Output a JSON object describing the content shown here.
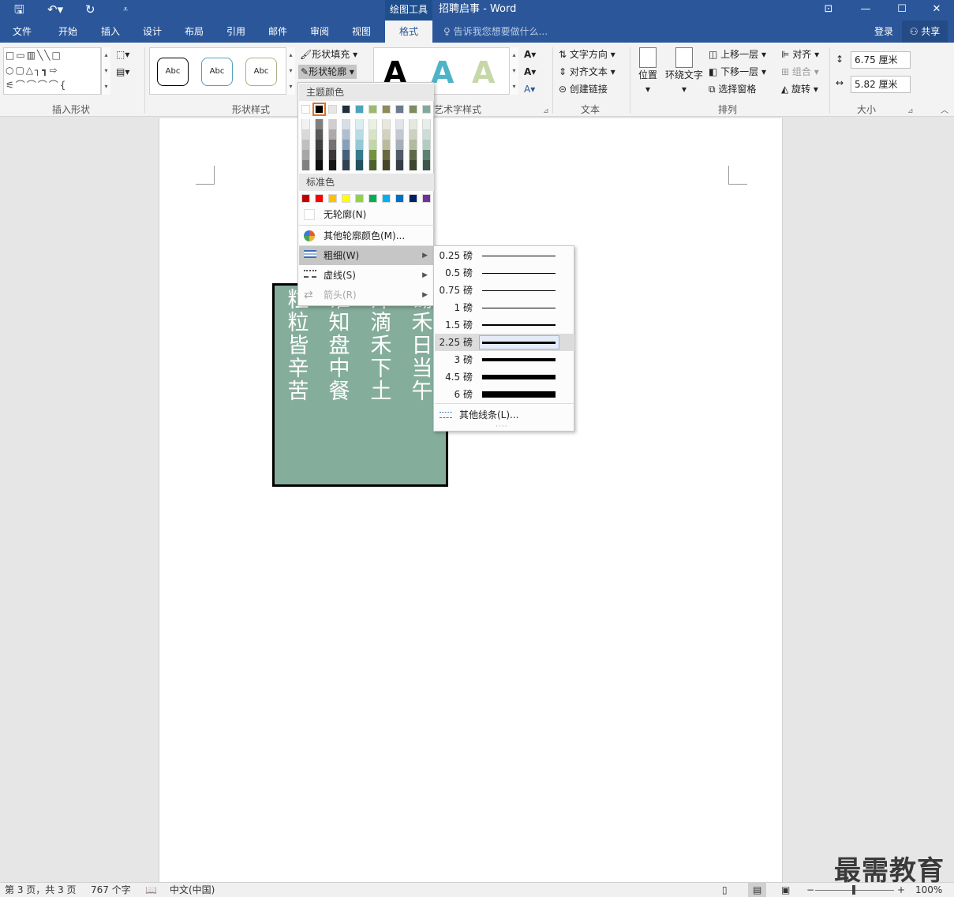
{
  "app": {
    "window_title": "招聘启事 - Word",
    "context_tab_group": "绘图工具"
  },
  "tabs": [
    "文件",
    "开始",
    "插入",
    "设计",
    "布局",
    "引用",
    "邮件",
    "审阅",
    "视图",
    "格式"
  ],
  "active_tab": "格式",
  "tell_me": "告诉我您想要做什么...",
  "login": "登录",
  "share": "共享",
  "ribbon": {
    "groups": [
      "插入形状",
      "形状样式",
      "艺术字样式",
      "文本",
      "排列",
      "大小"
    ],
    "shape_styles_sample": "Abc",
    "wordart_sample": "A",
    "shape_fill": "形状填充",
    "shape_outline": "形状轮廓",
    "text_direction": "文字方向",
    "align_text": "对齐文本",
    "create_link": "创建链接",
    "position": "位置",
    "wrap_text": "环绕文字",
    "bring_forward": "上移一层",
    "send_backward": "下移一层",
    "selection_pane": "选择窗格",
    "align": "对齐",
    "group": "组合",
    "rotate": "旋转",
    "height": "6.75 厘米",
    "width": "5.82 厘米"
  },
  "outline_menu": {
    "theme_colors_header": "主题颜色",
    "standard_colors_header": "标准色",
    "no_outline": "无轮廓(N)",
    "more_colors": "其他轮廓颜色(M)...",
    "weight": "粗细(W)",
    "dashes": "虚线(S)",
    "arrows": "箭头(R)",
    "theme_colors": [
      "#ffffff",
      "#000000",
      "#e7e6e6",
      "#1f2d3d",
      "#4fa3b8",
      "#9bbb6a",
      "#8c8c5a",
      "#6b7a8c",
      "#7f8c5f",
      "#7faa98"
    ],
    "theme_shades": [
      [
        "#f2f2f2",
        "#d9d9d9",
        "#bfbfbf",
        "#a6a6a6",
        "#808080"
      ],
      [
        "#7f7f7f",
        "#595959",
        "#3f3f3f",
        "#262626",
        "#0d0d0d"
      ],
      [
        "#d0cece",
        "#aeaaaa",
        "#757171",
        "#3a3838",
        "#171616"
      ],
      [
        "#d6dfe8",
        "#aebfd0",
        "#86a0b9",
        "#46607a",
        "#2f4050"
      ],
      [
        "#dcedf1",
        "#b9dbe3",
        "#95c8d4",
        "#357a8b",
        "#23515d"
      ],
      [
        "#ebf1e1",
        "#d7e4c3",
        "#c3d6a6",
        "#72923f",
        "#4c612a"
      ],
      [
        "#e8e8de",
        "#d1d1be",
        "#bbba9d",
        "#69693f",
        "#46462a"
      ],
      [
        "#e1e4e8",
        "#c3c9d1",
        "#a6aeba",
        "#505b69",
        "#353d46"
      ],
      [
        "#e5e8df",
        "#cbd1bf",
        "#b2ba9f",
        "#5f6947",
        "#3f4630"
      ],
      [
        "#e5eeea",
        "#cbddd6",
        "#b2ccc1",
        "#5a8271",
        "#3c564b"
      ]
    ],
    "standard_colors": [
      "#c00000",
      "#ff0000",
      "#ffc000",
      "#ffff00",
      "#92d050",
      "#00b050",
      "#00b0f0",
      "#0070c0",
      "#002060",
      "#7030a0"
    ]
  },
  "weight_menu": {
    "items": [
      {
        "label": "0.25 磅",
        "pt": 0.25
      },
      {
        "label": "0.5 磅",
        "pt": 0.5
      },
      {
        "label": "0.75 磅",
        "pt": 0.75
      },
      {
        "label": "1 磅",
        "pt": 1
      },
      {
        "label": "1.5 磅",
        "pt": 1.5
      },
      {
        "label": "2.25 磅",
        "pt": 2.25
      },
      {
        "label": "3 磅",
        "pt": 3
      },
      {
        "label": "4.5 磅",
        "pt": 4.5
      },
      {
        "label": "6 磅",
        "pt": 6
      }
    ],
    "selected": "2.25 磅",
    "more_lines": "其他线条(L)..."
  },
  "poem": {
    "columns": [
      "锄禾日当午",
      "汗滴禾下土",
      "谁知盘中餐",
      "粒粒皆辛苦"
    ],
    "fill_color": "#85ad9c"
  },
  "status": {
    "page": "第 3 页，共 3 页",
    "words": "767 个字",
    "language": "中文(中国)",
    "zoom": "100%"
  },
  "watermark": "最需教育"
}
